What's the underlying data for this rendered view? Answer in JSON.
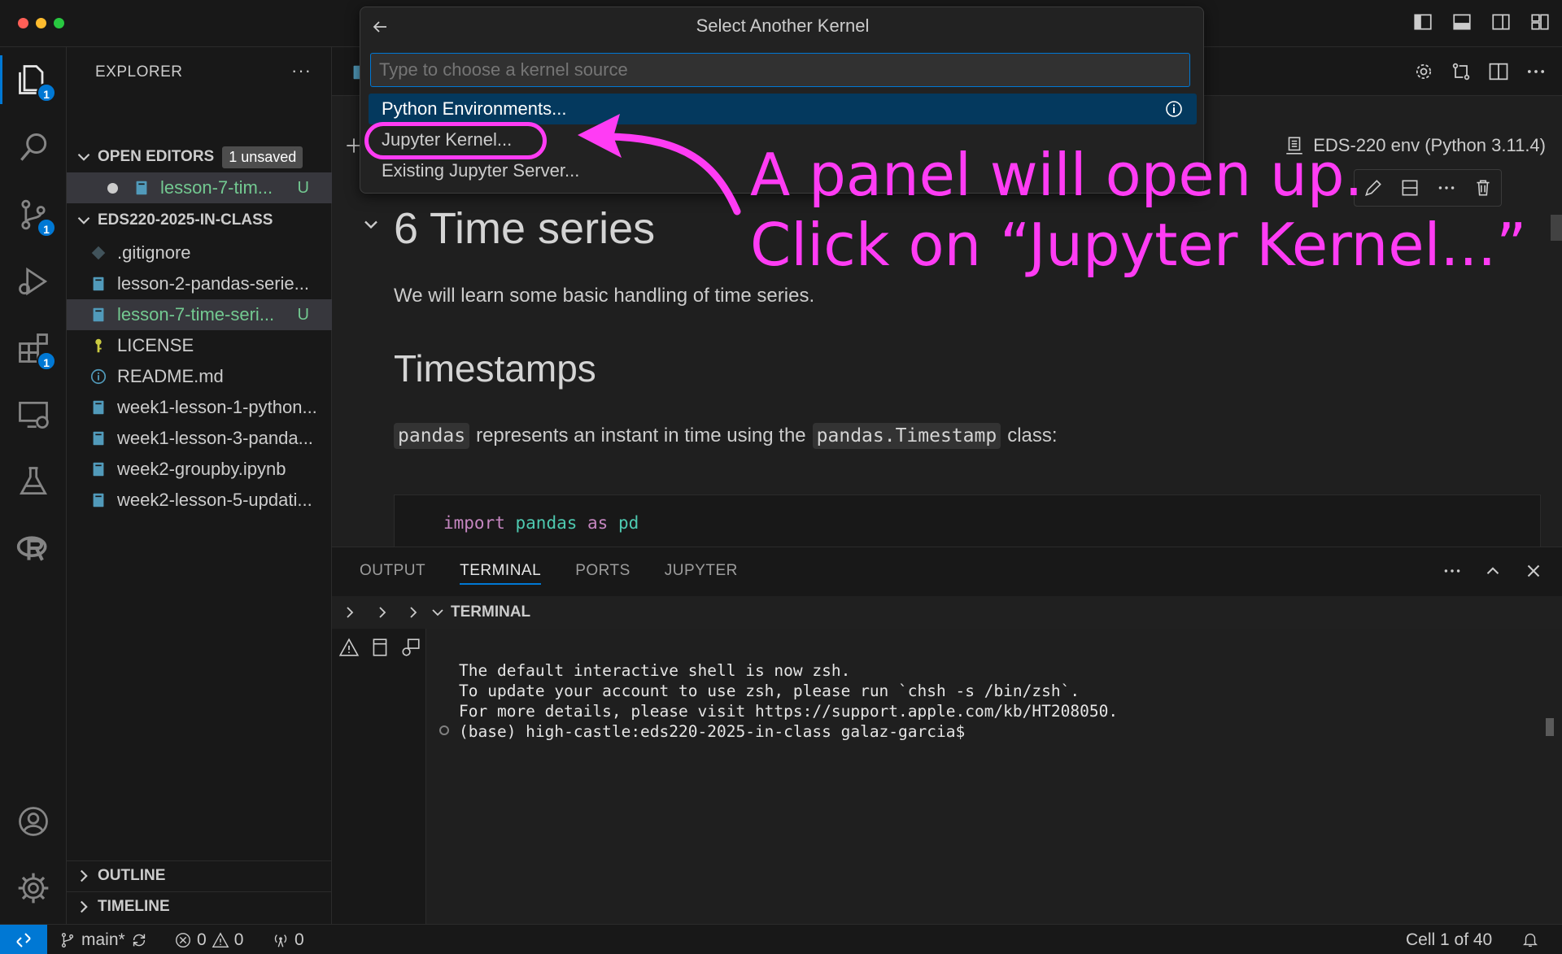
{
  "window": {
    "traffic_colors": [
      "#ff5f57",
      "#febc2e",
      "#28c840"
    ]
  },
  "activity": {
    "explorer_badge": "1",
    "scm_badge": "1",
    "extensions_badge": "1"
  },
  "sidebar": {
    "title": "EXPLORER",
    "open_editors": {
      "label": "OPEN EDITORS",
      "unsaved": "1 unsaved",
      "items": [
        {
          "name": "lesson-7-tim...",
          "status": "U"
        }
      ]
    },
    "folder": {
      "label": "EDS220-2025-IN-CLASS",
      "items": [
        {
          "name": ".gitignore",
          "status": ""
        },
        {
          "name": "lesson-2-pandas-serie...",
          "status": ""
        },
        {
          "name": "lesson-7-time-seri...",
          "status": "U"
        },
        {
          "name": "LICENSE",
          "status": ""
        },
        {
          "name": "README.md",
          "status": ""
        },
        {
          "name": "week1-lesson-1-python...",
          "status": ""
        },
        {
          "name": "week1-lesson-3-panda...",
          "status": ""
        },
        {
          "name": "week2-groupby.ipynb",
          "status": ""
        },
        {
          "name": "week2-lesson-5-updati...",
          "status": ""
        }
      ]
    },
    "outline": "OUTLINE",
    "timeline": "TIMELINE"
  },
  "quickpick": {
    "title": "Select Another Kernel",
    "placeholder": "Type to choose a kernel source",
    "items": [
      {
        "label": "Python Environments..."
      },
      {
        "label": "Jupyter Kernel..."
      },
      {
        "label": "Existing Jupyter Server..."
      }
    ]
  },
  "annotation": {
    "line1": "A panel will open up.",
    "line2": "Click on “Jupyter Kernel...”",
    "color": "#ff3cf4"
  },
  "editor": {
    "kernel": "EDS-220 env (Python 3.11.4)",
    "heading": "6 Time series",
    "intro": "We will learn some basic handling of time series.",
    "subheading": "Timestamps",
    "para_code1": "pandas",
    "para_mid": "represents an instant in time using the",
    "para_code2": "pandas.Timestamp",
    "para_end": "class:",
    "code": {
      "kw_import": "import",
      "module": "pandas",
      "kw_as": "as",
      "alias": "pd"
    }
  },
  "panel": {
    "tabs": [
      "OUTPUT",
      "TERMINAL",
      "PORTS",
      "JUPYTER"
    ],
    "terminal_label": "TERMINAL",
    "lines": [
      "The default interactive shell is now zsh.",
      "To update your account to use zsh, please run `chsh -s /bin/zsh`.",
      "For more details, please visit https://support.apple.com/kb/HT208050.",
      "(base) high-castle:eds220-2025-in-class galaz-garcia$"
    ]
  },
  "status": {
    "branch": "main*",
    "errors": "0",
    "warnings": "0",
    "ports": "0",
    "cell": "Cell 1 of 40"
  }
}
